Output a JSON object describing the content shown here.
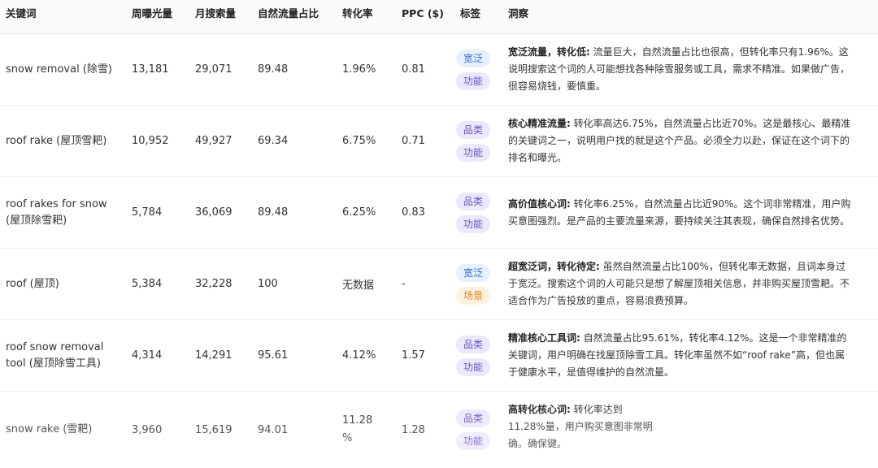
{
  "headers": {
    "keyword": "关键词",
    "weekly_impressions": "周曝光量",
    "monthly_searches": "月搜索量",
    "organic_share": "自然流量占比",
    "conversion_rate": "转化率",
    "ppc": "PPC ($)",
    "tags": "标签",
    "insight": "洞察"
  },
  "tag_colors": {
    "blue": "#2f6fd8",
    "purple": "#6b53c7",
    "orange": "#e8841c"
  },
  "rows": [
    {
      "keyword": "snow removal (除雪)",
      "weekly_impressions": "13,181",
      "monthly_searches": "29,071",
      "organic_share": "89.48",
      "conversion_rate": "1.96%",
      "ppc": "0.81",
      "tags": [
        "宽泛",
        "功能"
      ],
      "insight_title": "宽泛流量，转化低:",
      "insight_text": "流量巨大，自然流量占比也很高，但转化率只有1.96%。这说明搜索这个词的人可能想找各种除雪服务或工具，需求不精准。如果做广告，很容易烧钱，要慎重。"
    },
    {
      "keyword": "roof rake (屋顶雪耙)",
      "weekly_impressions": "10,952",
      "monthly_searches": "49,927",
      "organic_share": "69.34",
      "conversion_rate": "6.75%",
      "ppc": "0.71",
      "tags": [
        "品类",
        "功能"
      ],
      "insight_title": "核心精准流量:",
      "insight_text": "转化率高达6.75%，自然流量占比近70%。这是最核心、最精准的关键词之一，说明用户找的就是这个产品。必须全力以赴，保证在这个词下的排名和曝光。"
    },
    {
      "keyword": "roof rakes for snow (屋顶除雪耙)",
      "weekly_impressions": "5,784",
      "monthly_searches": "36,069",
      "organic_share": "89.48",
      "conversion_rate": "6.25%",
      "ppc": "0.83",
      "tags": [
        "品类",
        "功能"
      ],
      "insight_title": "高价值核心词:",
      "insight_text": "转化率6.25%，自然流量占比近90%。这个词非常精准，用户购买意图强烈。是产品的主要流量来源，要持续关注其表现，确保自然排名优势。"
    },
    {
      "keyword": "roof (屋顶)",
      "weekly_impressions": "5,384",
      "monthly_searches": "32,228",
      "organic_share": "100",
      "conversion_rate": "无数据",
      "ppc": "-",
      "tags": [
        "宽泛",
        "场景"
      ],
      "insight_title": "超宽泛词，转化待定:",
      "insight_text": "虽然自然流量占比100%，但转化率无数据，且词本身过于宽泛。搜索这个词的人可能只是想了解屋顶相关信息，并非购买屋顶雪耙。不适合作为广告投放的重点，容易浪费预算。"
    },
    {
      "keyword": "roof snow removal tool (屋顶除雪工具)",
      "weekly_impressions": "4,314",
      "monthly_searches": "14,291",
      "organic_share": "95.61",
      "conversion_rate": "4.12%",
      "ppc": "1.57",
      "tags": [
        "品类",
        "功能"
      ],
      "insight_title": "精准核心工具词:",
      "insight_text": "自然流量占比95.61%，转化率4.12%。这是一个非常精准的关键词，用户明确在找屋顶除雪工具。转化率虽然不如“roof rake”高，但也属于健康水平，是值得维护的自然流量。"
    },
    {
      "keyword": "snow rake (雪耙)",
      "weekly_impressions": "3,960",
      "monthly_searches": "15,619",
      "organic_share": "94.01",
      "conversion_rate": "11.28 %",
      "ppc": "1.28",
      "tags": [
        "品类",
        "功能"
      ],
      "insight_title": "高转化核心词:",
      "insight_text": "转化率达到11.28%量，用户购买意图非常明确。确保键。"
    }
  ]
}
